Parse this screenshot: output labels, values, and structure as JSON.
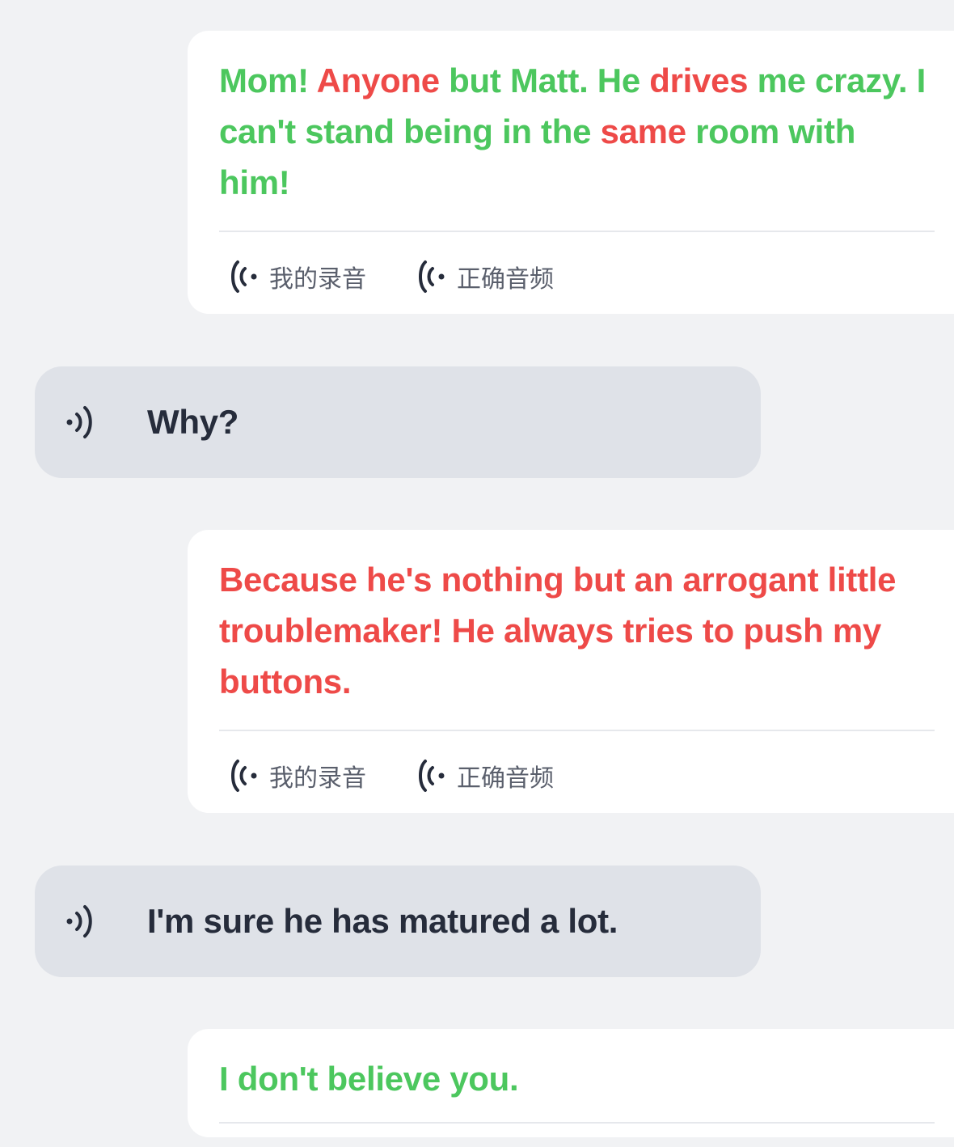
{
  "messages": [
    {
      "role": "user",
      "words": [
        {
          "t": "Mom! ",
          "s": "good"
        },
        {
          "t": "Anyone",
          "s": "bad"
        },
        {
          "t": " but Matt. He ",
          "s": "good"
        },
        {
          "t": "drives",
          "s": "bad"
        },
        {
          "t": " me crazy. I can't stand being in the ",
          "s": "good"
        },
        {
          "t": "same",
          "s": "bad"
        },
        {
          "t": " room with him!",
          "s": "good"
        }
      ],
      "my_recording_label": "我的录音",
      "correct_audio_label": "正确音频"
    },
    {
      "role": "bot",
      "text": "Why?"
    },
    {
      "role": "user",
      "words": [
        {
          "t": "Because he's nothing but an arrogant little troublemaker! He always tries to push my buttons.",
          "s": "bad"
        }
      ],
      "my_recording_label": "我的录音",
      "correct_audio_label": "正确音频"
    },
    {
      "role": "bot",
      "text": "I'm sure he has matured a lot."
    },
    {
      "role": "user",
      "words": [
        {
          "t": "I don't believe you.",
          "s": "good"
        }
      ]
    }
  ],
  "colors": {
    "correct_word": "#4cc75e",
    "incorrect_word": "#ee4a48",
    "bot_text": "#262c3b",
    "bot_bubble": "#dfe2e8",
    "user_card": "#ffffff",
    "background": "#f1f2f4"
  },
  "icons": {
    "user_audio": "sound-wave-left-icon",
    "bot_audio": "speaker-wave-icon"
  }
}
